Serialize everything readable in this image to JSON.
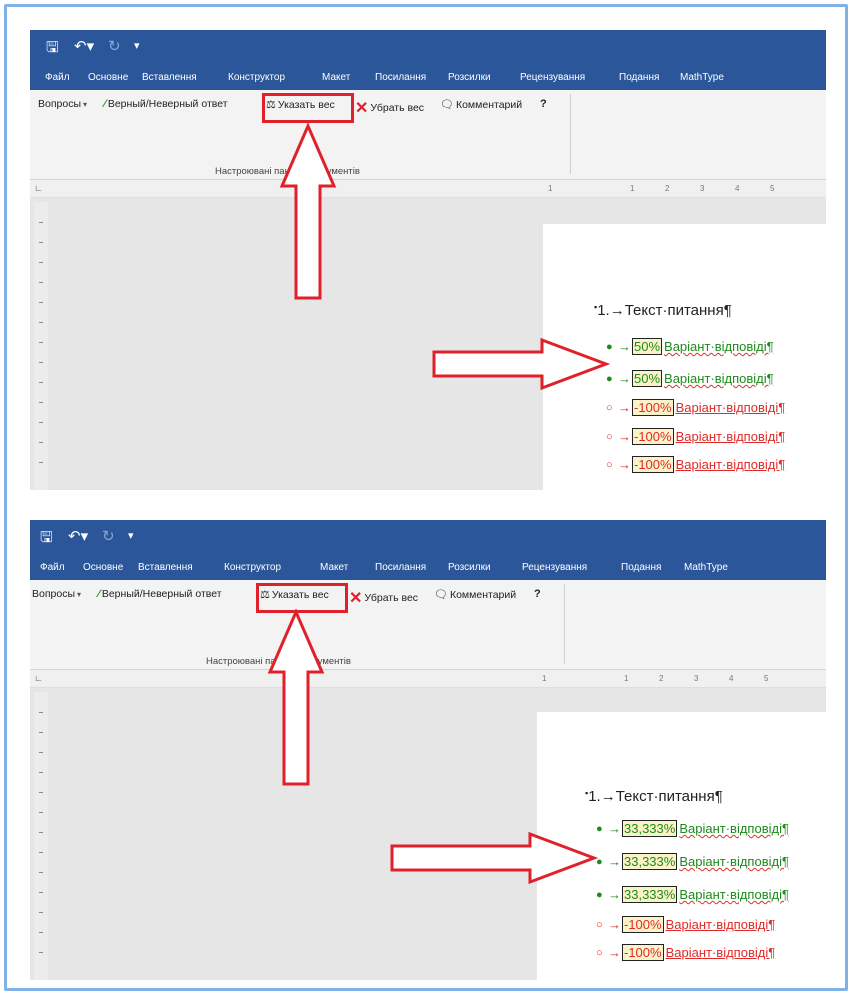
{
  "panels": [
    {
      "quick_access": {
        "save_icon": "save-icon",
        "undo_icon": "undo-icon",
        "redo_icon": "redo-icon",
        "customize_label": "▾"
      },
      "menu": [
        "Файл",
        "Основне",
        "Вставлення",
        "Конструктор",
        "Макет",
        "Посилання",
        "Розсилки",
        "Рецензування",
        "Подання",
        "MathType"
      ],
      "toolbar": {
        "questions": "Вопросы",
        "true_false": "Верный/Неверный ответ",
        "set_weight": "Указать вес",
        "remove_weight": "Убрать вес",
        "comment": "Комментарий",
        "group_label": "Настроювані панелі інструментів"
      },
      "ruler_numbers": [
        "1",
        "1",
        "2",
        "3",
        "4",
        "5"
      ],
      "question": "1.→Текст·питання¶",
      "answers": [
        {
          "weight": "50%",
          "text": "Варіант·відповіді¶",
          "correct": true
        },
        {
          "weight": "50%",
          "text": "Варіант·відповіді¶",
          "correct": true
        },
        {
          "weight": "-100%",
          "text": "Варіант·відповіді¶",
          "correct": false
        },
        {
          "weight": "-100%",
          "text": "Варіант·відповіді¶",
          "correct": false
        },
        {
          "weight": "-100%",
          "text": "Варіант·відповіді¶",
          "correct": false
        }
      ]
    },
    {
      "quick_access": {
        "save_icon": "save-icon",
        "undo_icon": "undo-icon",
        "redo_icon": "redo-icon",
        "customize_label": "▾"
      },
      "menu": [
        "Файл",
        "Основне",
        "Вставлення",
        "Конструктор",
        "Макет",
        "Посилання",
        "Розсилки",
        "Рецензування",
        "Подання",
        "MathType"
      ],
      "toolbar": {
        "questions": "Вопросы",
        "true_false": "Верный/Неверный ответ",
        "set_weight": "Указать вес",
        "remove_weight": "Убрать вес",
        "comment": "Комментарий",
        "group_label": "Настроювані панелі інструментів"
      },
      "ruler_numbers": [
        "1",
        "1",
        "2",
        "3",
        "4",
        "5"
      ],
      "question": "1.→Текст·питання¶",
      "answers": [
        {
          "weight": "33,333%",
          "text": "Варіант·відповіді¶",
          "correct": true
        },
        {
          "weight": "33,333%",
          "text": "Варіант·відповіді¶",
          "correct": true
        },
        {
          "weight": "33,333%",
          "text": "Варіант·відповіді¶",
          "correct": true
        },
        {
          "weight": "-100%",
          "text": "Варіант·відповіді¶",
          "correct": false
        },
        {
          "weight": "-100%",
          "text": "Варіант·відповіді¶",
          "correct": false
        }
      ]
    }
  ],
  "colors": {
    "ribbon_blue": "#2b579a",
    "highlight_red": "#e0202a",
    "correct_green": "#1d8a1d",
    "wrong_red": "#e02a2a",
    "weight_fill": "#fbf3c8"
  }
}
